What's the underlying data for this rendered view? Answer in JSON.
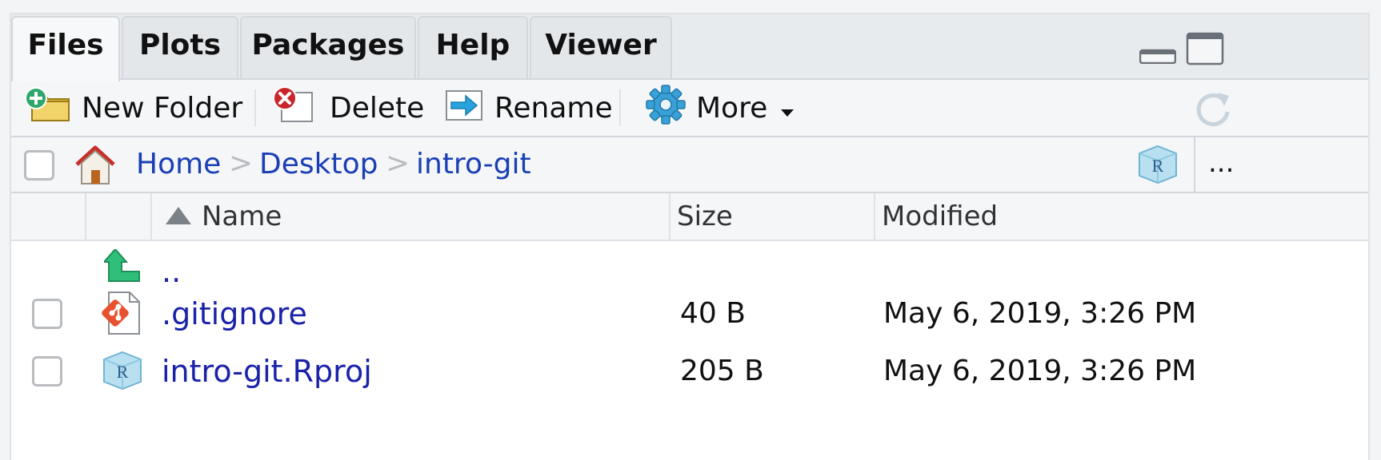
{
  "tabs": [
    {
      "label": "Files",
      "active": true
    },
    {
      "label": "Plots",
      "active": false
    },
    {
      "label": "Packages",
      "active": false
    },
    {
      "label": "Help",
      "active": false
    },
    {
      "label": "Viewer",
      "active": false
    }
  ],
  "toolbar": {
    "new_folder": "New Folder",
    "delete": "Delete",
    "rename": "Rename",
    "more": "More"
  },
  "breadcrumb": {
    "items": [
      "Home",
      "Desktop",
      "intro-git"
    ],
    "separator": ">",
    "more": "..."
  },
  "columns": {
    "name": "Name",
    "size": "Size",
    "modified": "Modified"
  },
  "rows": [
    {
      "name": "..",
      "icon": "up-arrow-icon"
    },
    {
      "name": ".gitignore",
      "size": "40 B",
      "modified": "May 6, 2019, 3:26 PM",
      "icon": "git-file-icon"
    },
    {
      "name": "intro-git.Rproj",
      "size": "205 B",
      "modified": "May 6, 2019, 3:26 PM",
      "icon": "rproj-file-icon"
    }
  ],
  "colors": {
    "link": "#1a22a8",
    "crumb": "#1a3fb5",
    "border": "#d3d8dd"
  }
}
